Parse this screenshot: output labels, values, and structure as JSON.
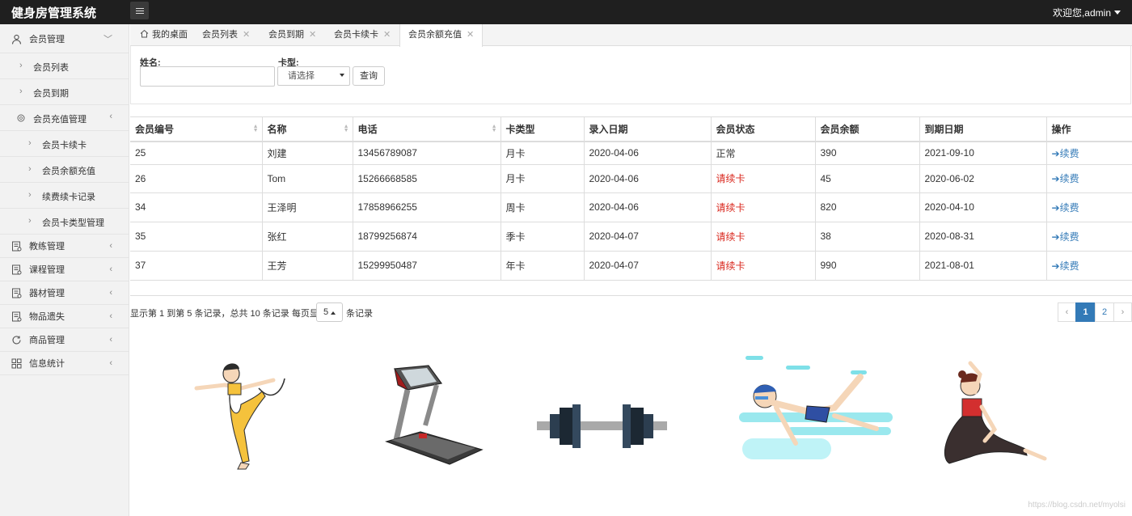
{
  "app": {
    "title": "健身房管理系统",
    "user_greeting": "欢迎您,admin"
  },
  "sidebar": {
    "groups": [
      {
        "label": "会员管理",
        "icon": "user-icon"
      },
      {
        "label": "会员列表"
      },
      {
        "label": "会员到期"
      },
      {
        "label": "会员充值管理",
        "icon": "circle-icon"
      },
      {
        "label": "会员卡续卡"
      },
      {
        "label": "会员余额充值"
      },
      {
        "label": "续费续卡记录"
      },
      {
        "label": "会员卡类型管理"
      },
      {
        "label": "教练管理",
        "icon": "document-icon"
      },
      {
        "label": "课程管理",
        "icon": "document-icon"
      },
      {
        "label": "器材管理",
        "icon": "document-icon"
      },
      {
        "label": "物品遗失",
        "icon": "document-icon"
      },
      {
        "label": "商品管理",
        "icon": "refresh-icon"
      },
      {
        "label": "信息统计",
        "icon": "grid-icon"
      }
    ]
  },
  "tabs": [
    {
      "label": "我的桌面"
    },
    {
      "label": "会员列表"
    },
    {
      "label": "会员到期"
    },
    {
      "label": "会员卡续卡"
    },
    {
      "label": "会员余额充值"
    }
  ],
  "search": {
    "name_label": "姓名:",
    "name_value": "",
    "card_label": "卡型:",
    "card_selected": "请选择",
    "query_button": "查询"
  },
  "table": {
    "columns": [
      "会员编号",
      "名称",
      "电话",
      "卡类型",
      "录入日期",
      "会员状态",
      "会员余额",
      "到期日期",
      "操作"
    ],
    "rows": [
      [
        "25",
        "刘建",
        "13456789087",
        "月卡",
        "2020-04-06",
        "正常",
        "390",
        "2021-09-10",
        "续费"
      ],
      [
        "26",
        "Tom",
        "15266668585",
        "月卡",
        "2020-04-06",
        "请续卡",
        "45",
        "2020-06-02",
        "续费"
      ],
      [
        "34",
        "王泽明",
        "17858966255",
        "周卡",
        "2020-04-06",
        "请续卡",
        "820",
        "2020-04-10",
        "续费"
      ],
      [
        "35",
        "张红",
        "18799256874",
        "季卡",
        "2020-04-07",
        "请续卡",
        "38",
        "2020-08-31",
        "续费"
      ],
      [
        "37",
        "王芳",
        "15299950487",
        "年卡",
        "2020-04-07",
        "请续卡",
        "990",
        "2021-08-01",
        "续费"
      ]
    ]
  },
  "pagination": {
    "info": "显示第 1 到第 5 条记录，总共 10 条记录 每页显示",
    "page_size": "5",
    "suffix": "条记录",
    "prev": "‹",
    "pages": [
      "1",
      "2"
    ],
    "next": "›"
  },
  "watermark": "https://blog.csdn.net/myolsi",
  "colors": {
    "accent": "#337ab7",
    "warn": "#d9261c",
    "topbar": "#1f1f1f"
  }
}
